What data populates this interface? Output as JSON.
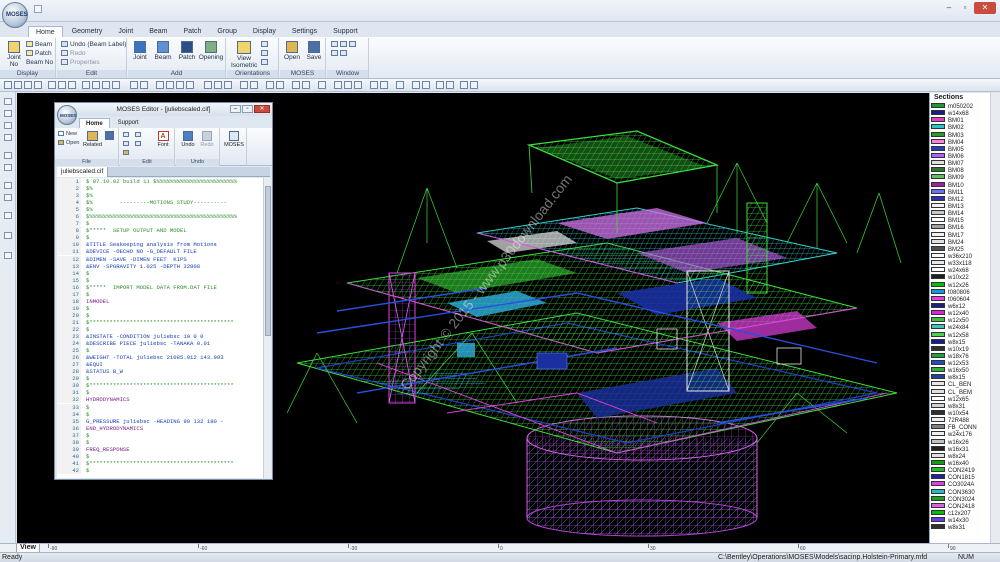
{
  "app": {
    "orb_label": "MOSES",
    "window_controls": [
      "–",
      "▫",
      "✕"
    ]
  },
  "ribbon": {
    "tabs": [
      "Home",
      "Geometry",
      "Joint",
      "Beam",
      "Patch",
      "Group",
      "Display",
      "Settings",
      "Support"
    ],
    "active_tab": "Home",
    "display_group": {
      "name": "Display",
      "joint_no": "Joint No",
      "beam": "Beam",
      "patch": "Patch",
      "beam_no": "Beam No"
    },
    "edit_group": {
      "name": "Edit",
      "undo": "Undo (Beam Label)",
      "redo": "Redo",
      "properties": "Properties"
    },
    "add_group": {
      "name": "Add",
      "joint": "Joint",
      "beam": "Beam",
      "patch": "Patch",
      "opening": "Opening"
    },
    "orientations_group": {
      "name": "Orientations",
      "view_isometric": "View Isometric"
    },
    "moses_group": {
      "name": "MOSES",
      "open": "Open",
      "save": "Save"
    },
    "window_group": {
      "name": "Window"
    }
  },
  "sections": {
    "title": "Sections",
    "items": [
      {
        "label": "m050202",
        "color": "#1a9a2f"
      },
      {
        "label": "w14x68",
        "color": "#1a1a8a"
      },
      {
        "label": "BM01",
        "color": "#e040c8"
      },
      {
        "label": "BM02",
        "color": "#20c8c8"
      },
      {
        "label": "BM03",
        "color": "#2a9a2a"
      },
      {
        "label": "BM04",
        "color": "#ff80e0"
      },
      {
        "label": "BM05",
        "color": "#2040c0"
      },
      {
        "label": "BM06",
        "color": "#b060ff"
      },
      {
        "label": "BM07",
        "color": "#e0e0e0"
      },
      {
        "label": "BM08",
        "color": "#2a7a2a"
      },
      {
        "label": "BM09",
        "color": "#60c060"
      },
      {
        "label": "BM10",
        "color": "#a020a0"
      },
      {
        "label": "BM11",
        "color": "#7070ff"
      },
      {
        "label": "BM12",
        "color": "#3030b0"
      },
      {
        "label": "BM13",
        "color": "#f0f0f0"
      },
      {
        "label": "BM14",
        "color": "#c8c8c8"
      },
      {
        "label": "BM15",
        "color": "#ffffff"
      },
      {
        "label": "BM16",
        "color": "#a0a0a0"
      },
      {
        "label": "BM17",
        "color": "#f0f0f0"
      },
      {
        "label": "BM24",
        "color": "#e0e0e0"
      },
      {
        "label": "BM25",
        "color": "#505050"
      },
      {
        "label": "w36x210",
        "color": "#f8f8f8"
      },
      {
        "label": "w33x118",
        "color": "#e8e8e8"
      },
      {
        "label": "w24x68",
        "color": "#ffffff"
      },
      {
        "label": "w10x22",
        "color": "#202020"
      },
      {
        "label": "w12x26",
        "color": "#00c000"
      },
      {
        "label": "t080806",
        "color": "#00a0e0"
      },
      {
        "label": "t060604",
        "color": "#e040e0"
      },
      {
        "label": "w6x12",
        "color": "#202080"
      },
      {
        "label": "w12x40",
        "color": "#e020e0"
      },
      {
        "label": "w12x50",
        "color": "#40c040"
      },
      {
        "label": "w24x84",
        "color": "#40c0c0"
      },
      {
        "label": "w12x58",
        "color": "#50d050"
      },
      {
        "label": "w8x15",
        "color": "#102090"
      },
      {
        "label": "w10x19",
        "color": "#303030"
      },
      {
        "label": "w18x76",
        "color": "#20a040"
      },
      {
        "label": "w12x53",
        "color": "#2050c0"
      },
      {
        "label": "w16x50",
        "color": "#30b030"
      },
      {
        "label": "w8x15",
        "color": "#2040a0"
      },
      {
        "label": "CL_BEN",
        "color": "#e8e8e8"
      },
      {
        "label": "CL_BEM",
        "color": "#e0e0e0"
      },
      {
        "label": "w12x65",
        "color": "#ffffff"
      },
      {
        "label": "w8x31",
        "color": "#d0d0d0"
      },
      {
        "label": "w10x54",
        "color": "#303030"
      },
      {
        "label": "72R488",
        "color": "#f0f0f0"
      },
      {
        "label": "FB_CONN",
        "color": "#808080"
      },
      {
        "label": "w24x176",
        "color": "#f0f0f0"
      },
      {
        "label": "w16x26",
        "color": "#c0c0c0"
      },
      {
        "label": "w16x31",
        "color": "#202020"
      },
      {
        "label": "w8x24",
        "color": "#e0e0e0"
      },
      {
        "label": "w16x40",
        "color": "#10a010"
      },
      {
        "label": "CON2419",
        "color": "#20c020"
      },
      {
        "label": "CON1815",
        "color": "#2020a0"
      },
      {
        "label": "CO3024A",
        "color": "#e040e0"
      },
      {
        "label": "CON3630",
        "color": "#20c0c0"
      },
      {
        "label": "CON3024",
        "color": "#20a020"
      },
      {
        "label": "CON2418",
        "color": "#e060e0"
      },
      {
        "label": "c12x207",
        "color": "#00c000"
      },
      {
        "label": "w14x30",
        "color": "#6040e0"
      },
      {
        "label": "w8x31",
        "color": "#303030"
      }
    ]
  },
  "viewport": {
    "watermark": "Copyright © 2015 - www.p30download.com"
  },
  "bottom": {
    "view_tab": "View",
    "ruler_labels": [
      "-90",
      "-60",
      "-30",
      "0",
      "30",
      "60",
      "90"
    ]
  },
  "status": {
    "left": "Ready",
    "path": "C:\\Bentley\\Operations\\MOSES\\Models\\sacinp.Holstein-Primary.mfd",
    "num": "NUM"
  },
  "editor": {
    "title": "MOSES Editor - [juliebscaled.cif]",
    "orb_label": "MOSES",
    "tabs": [
      "Home",
      "Support"
    ],
    "file": {
      "name": "File",
      "new": "New",
      "open": "Open",
      "related": "Related"
    },
    "edit": {
      "name": "Edit",
      "font": "Font"
    },
    "undo_group": {
      "name": "Undo",
      "undo": "Undo",
      "redo": "Redo"
    },
    "moses_label": "MOSES",
    "file_tab": "juliebscaled.cif",
    "lines": [
      {
        "n": "1",
        "t": "$ 07.10.02 build 11 $%%%%%%%%%%%%%%%%%%%%%%%%",
        "k": "cm"
      },
      {
        "n": "2",
        "t": "$%",
        "k": "cm"
      },
      {
        "n": "3",
        "t": "$%",
        "k": "cm"
      },
      {
        "n": "4",
        "t": "$%        ---------MOTIONS STUDY----------",
        "k": "cm"
      },
      {
        "n": "5",
        "t": "$%",
        "k": "cm"
      },
      {
        "n": "6",
        "t": "$%%%%%%%%%%%%%%%%%%%%%%%%%%%%%%%%%%%%%%%%%%%%",
        "k": "cm"
      },
      {
        "n": "7",
        "t": "$",
        "k": "cm"
      },
      {
        "n": "8",
        "t": "$*****  SETUP OUTPUT AND MODEL",
        "k": "cm"
      },
      {
        "n": "9",
        "t": "$",
        "k": "cm"
      },
      {
        "n": "10",
        "t": "&TITLE Seakeeping analysis from Motions",
        "k": "kw"
      },
      {
        "n": "11",
        "t": "&DEVICE -OECHO NO -G_DEFAULT FILE",
        "k": "kw"
      },
      {
        "n": "12",
        "t": "&DIMEN -SAVE -DIMEN FEET  KIPS",
        "k": "kw"
      },
      {
        "n": "13",
        "t": "&ENV -SPGRAVITY 1.025 -DEPTH 32808",
        "k": "kw"
      },
      {
        "n": "14",
        "t": "$",
        "k": "cm"
      },
      {
        "n": "15",
        "t": "$",
        "k": "cm"
      },
      {
        "n": "16",
        "t": "$*****  IMPORT MODEL DATA FROM.DAT FILE",
        "k": "cm"
      },
      {
        "n": "17",
        "t": "$",
        "k": "cm"
      },
      {
        "n": "18",
        "t": "INMODEL",
        "k": "tx"
      },
      {
        "n": "19",
        "t": "$",
        "k": "cm"
      },
      {
        "n": "20",
        "t": "$",
        "k": "cm"
      },
      {
        "n": "21",
        "t": "$*******************************************",
        "k": "cm"
      },
      {
        "n": "22",
        "t": "$",
        "k": "cm"
      },
      {
        "n": "23",
        "t": "&INSTATE -CONDITION juliebsc 10 0 0",
        "k": "kw"
      },
      {
        "n": "24",
        "t": "&DESCRIBE PIECE juliebsc -TANAKA 0.01",
        "k": "kw"
      },
      {
        "n": "25",
        "t": "$",
        "k": "cm"
      },
      {
        "n": "26",
        "t": "&WEIGHT -TOTAL juliebsc 21085.912 143.993",
        "k": "kw"
      },
      {
        "n": "27",
        "t": "&EQUI",
        "k": "kw"
      },
      {
        "n": "28",
        "t": "&STATUS B_W",
        "k": "kw"
      },
      {
        "n": "29",
        "t": "$",
        "k": "cm"
      },
      {
        "n": "30",
        "t": "$*******************************************",
        "k": "cm"
      },
      {
        "n": "31",
        "t": "$",
        "k": "cm"
      },
      {
        "n": "32",
        "t": "HYDRODYNAMICS",
        "k": "tx"
      },
      {
        "n": "33",
        "t": "$",
        "k": "cm"
      },
      {
        "n": "34",
        "t": "$",
        "k": "cm"
      },
      {
        "n": "35",
        "t": "G_PRESSURE juliebsc -HEADING 90 132 180 -",
        "k": "kw"
      },
      {
        "n": "36",
        "t": "END_HYDRODYNAMICS",
        "k": "tx"
      },
      {
        "n": "37",
        "t": "$",
        "k": "cm"
      },
      {
        "n": "38",
        "t": "$",
        "k": "cm"
      },
      {
        "n": "39",
        "t": "FREQ_RESPONSE",
        "k": "tx"
      },
      {
        "n": "40",
        "t": "$",
        "k": "cm"
      },
      {
        "n": "41",
        "t": "$*******************************************",
        "k": "cm"
      },
      {
        "n": "42",
        "t": "$",
        "k": "cm"
      }
    ]
  },
  "colors": {
    "viewport_bg": "#000000",
    "structure_green": "#3ddc3d",
    "structure_blue": "#2040c0",
    "structure_magenta": "#e040e0",
    "structure_cyan": "#30d0d0"
  }
}
